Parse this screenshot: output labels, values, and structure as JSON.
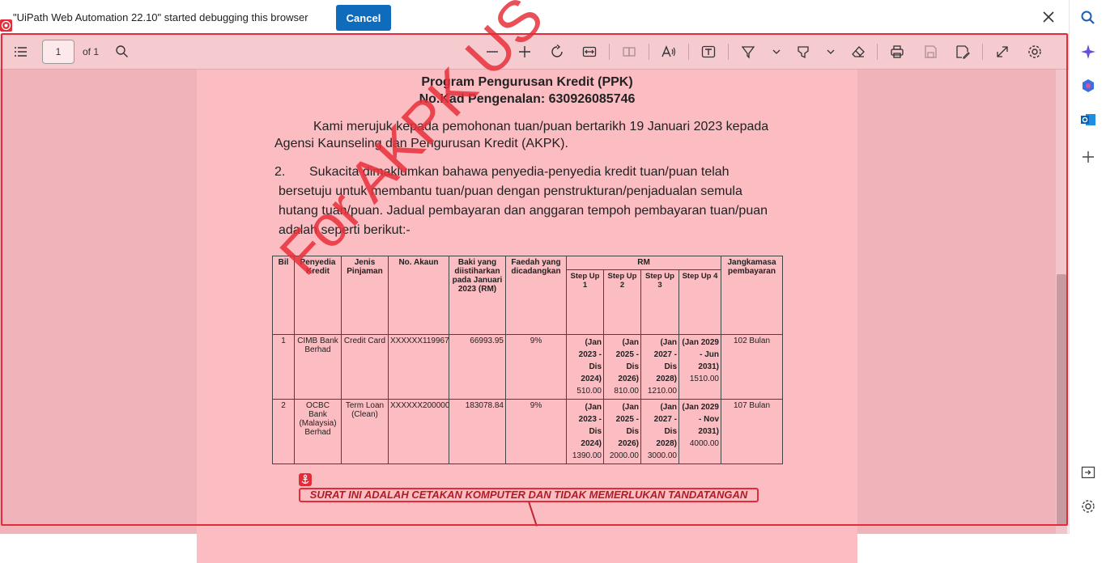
{
  "infobar": {
    "message": "\"UiPath Web Automation 22.10\" started debugging this browser",
    "cancel_label": "Cancel"
  },
  "toolbar": {
    "page_number": "1",
    "of_pages": "of 1"
  },
  "document": {
    "title1": "Program Pengurusan  Kredit (PPK)",
    "title2": "No.Kad Pengenalan:  630926085746",
    "para1_line1": "Kami merujuk kepada pemohonan tuan/puan bertarikh 19 Januari 2023 kepada",
    "para1_line2": "Agensi Kaunseling dan Pengurusan Kredit (AKPK).",
    "para2_num": "2.",
    "para2_line1": "Sukacita dimaklumkan bahawa penyedia-penyedia kredit tuan/puan telah",
    "para2_line2": "bersetuju untuk membantu tuan/puan dengan penstrukturan/penjadualan semula",
    "para2_line3": "hutang tuan/puan. Jadual pembayaran dan anggaran tempoh pembayaran tuan/puan",
    "para2_line4": "adalah seperti berikut:-",
    "watermark": "For AKPK US",
    "footnote": "SURAT INI ADALAH CETAKAN KOMPUTER DAN TIDAK MEMERLUKAN TANDATANGAN"
  },
  "table": {
    "headers": {
      "bil": "Bil",
      "penyedia": "Penyedia Kredit",
      "jenis": "Jenis Pinjaman",
      "akaun": "No. Akaun",
      "baki": "Baki yang diistiharkan pada Januari 2023  (RM)",
      "faedah": "Faedah yang dicadangkan",
      "rm": "RM",
      "step1": "Step Up 1",
      "step2": "Step Up 2",
      "step3": "Step Up 3",
      "step4": "Step Up 4",
      "jangka": "Jangkamasa pembayaran"
    },
    "rows": [
      {
        "bil": "1",
        "penyedia": "CIMB Bank Berhad",
        "jenis": "Credit Card",
        "akaun": "XXXXXX119967",
        "baki": "66993.95",
        "faedah": "9%",
        "s1_period": "(Jan 2023 - Dis 2024)",
        "s1_amt": "510.00",
        "s2_period": "(Jan 2025 - Dis 2026)",
        "s2_amt": "810.00",
        "s3_period": "(Jan 2027 - Dis 2028)",
        "s3_amt": "1210.00",
        "s4_period": "(Jan 2029 - Jun 2031)",
        "s4_amt": "1510.00",
        "jangka": "102 Bulan"
      },
      {
        "bil": "2",
        "penyedia": "OCBC Bank (Malaysia) Berhad",
        "jenis": "Term Loan (Clean)",
        "akaun": "XXXXXX200000",
        "baki": "183078.84",
        "faedah": "9%",
        "s1_period": "(Jan 2023 - Dis 2024)",
        "s1_amt": "1390.00",
        "s2_period": "(Jan 2025 - Dis 2026)",
        "s2_amt": "2000.00",
        "s3_period": "(Jan 2027 - Dis 2028)",
        "s3_amt": "3000.00",
        "s4_period": "(Jan 2029 - Nov 2031)",
        "s4_amt": "4000.00",
        "jangka": "107 Bulan"
      }
    ]
  },
  "colors": {
    "accent_blue": "#0f6cbd",
    "highlight_red": "#e22c3a"
  },
  "icons": {
    "toolbar": [
      "contents-icon",
      "search-icon",
      "zoom-out-icon",
      "zoom-in-icon",
      "rotate-icon",
      "fit-page-icon",
      "page-view-icon",
      "read-aloud-icon",
      "text-box-icon",
      "draw-icon",
      "chevron-down-icon",
      "highlight-icon",
      "chevron-down-icon",
      "eraser-icon",
      "print-icon",
      "save-icon",
      "save-as-icon",
      "fullscreen-icon",
      "settings-icon"
    ],
    "sidebar": [
      "search-icon",
      "copilot-icon",
      "microsoft365-icon",
      "outlook-icon",
      "add-icon",
      "sidebar-toggle-icon",
      "settings-icon"
    ]
  }
}
